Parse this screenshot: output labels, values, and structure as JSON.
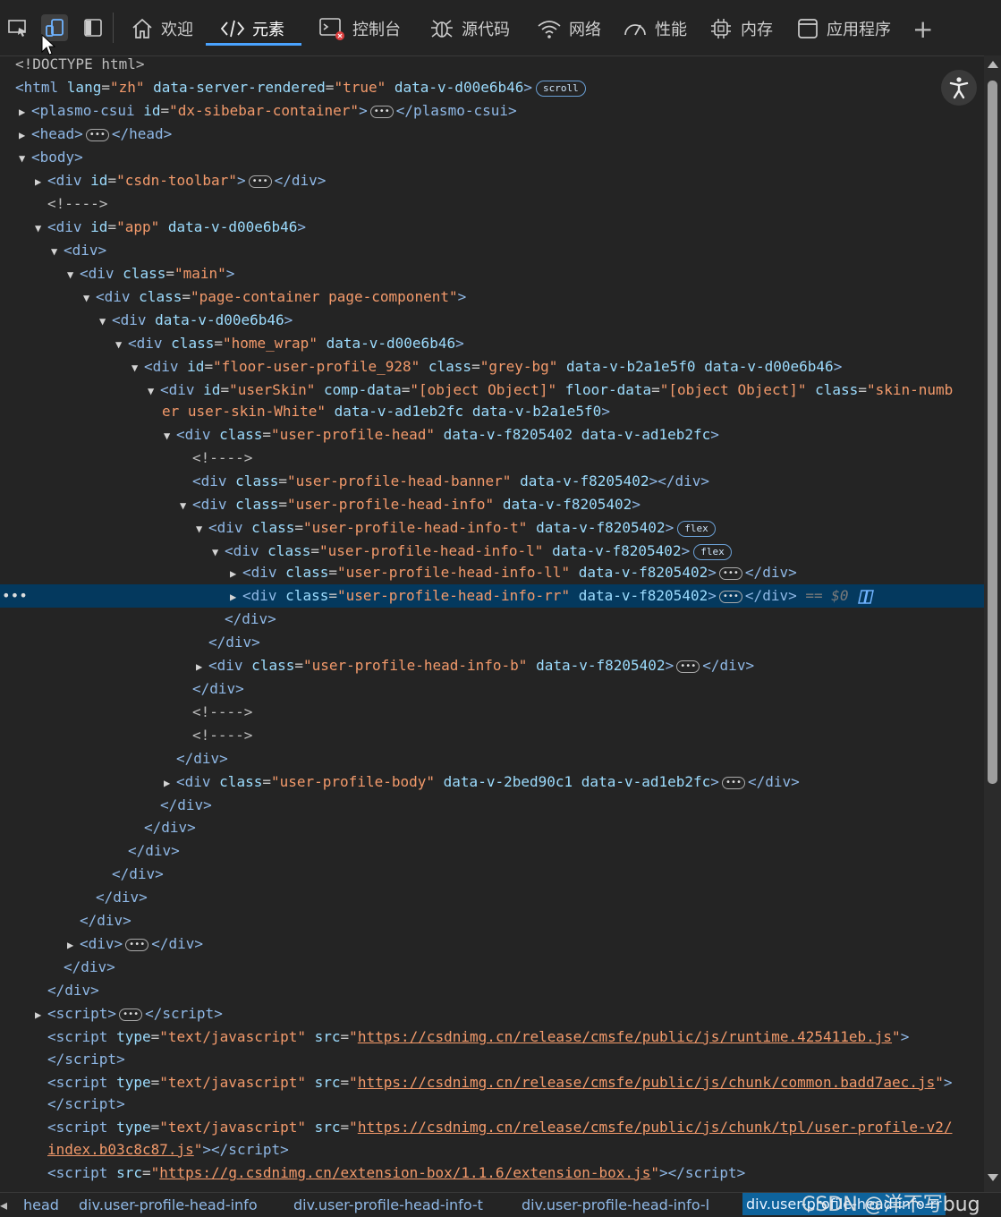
{
  "toolbar": {
    "tabs": [
      {
        "label": "欢迎",
        "icon": "home-icon"
      },
      {
        "label": "元素",
        "icon": "code-icon",
        "active": true
      },
      {
        "label": "控制台",
        "icon": "console-icon",
        "error": true
      },
      {
        "label": "源代码",
        "icon": "bug-icon"
      },
      {
        "label": "网络",
        "icon": "wifi-icon"
      },
      {
        "label": "性能",
        "icon": "gauge-icon"
      },
      {
        "label": "内存",
        "icon": "cpu-icon"
      },
      {
        "label": "应用程序",
        "icon": "window-icon"
      }
    ],
    "add_tab_label": "+"
  },
  "tree": {
    "doctype": "<!DOCTYPE html>",
    "html_lang": "\"zh\"",
    "server_rendered": "\"true\"",
    "data_v_root": "data-v-d00e6b46",
    "badge_scroll": "scroll",
    "badge_flex": "flex",
    "plasmo_id": "\"dx-sibebar-container\"",
    "comment": "<!---->",
    "toolbar_id": "\"csdn-toolbar\"",
    "app_id": "\"app\"",
    "class_main": "\"main\"",
    "class_page": "\"page-container page-component\"",
    "class_home": "\"home_wrap\"",
    "floor_id": "\"floor-user-profile_928\"",
    "class_grey": "\"grey-bg\"",
    "data_v_b2": "data-v-b2a1e5f0",
    "skin_id": "\"userSkin\"",
    "object_val": "\"[object Object]\"",
    "skin_class_1": "\"skin-numb",
    "skin_class_2": "er user-skin-White\"",
    "data_v_ad": "data-v-ad1eb2fc",
    "data_v_f8": "data-v-f8205402",
    "data_v_2b": "data-v-2bed90c1",
    "class_head": "\"user-profile-head\"",
    "class_banner": "\"user-profile-head-banner\"",
    "class_info": "\"user-profile-head-info\"",
    "class_info_t": "\"user-profile-head-info-t\"",
    "class_info_l": "\"user-profile-head-info-l\"",
    "class_info_ll": "\"user-profile-head-info-ll\"",
    "class_info_rr": "\"user-profile-head-info-rr\"",
    "class_info_b": "\"user-profile-head-info-b\"",
    "class_body": "\"user-profile-body\"",
    "selected_marker": "== $0",
    "script_type": "\"text/javascript\"",
    "url_runtime": "https://csdnimg.cn/release/cmsfe/public/js/runtime.425411eb.js",
    "url_common": "https://csdnimg.cn/release/cmsfe/public/js/chunk/common.badd7aec.js",
    "url_tpl_1": "https://csdnimg.cn/release/cmsfe/public/js/chunk/tpl/user-profile-v2/",
    "url_tpl_2": "index.b03c8c87.js",
    "url_ext": "https://g.csdnimg.cn/extension-box/1.1.6/extension-box.js"
  },
  "breadcrumb": [
    "head",
    "div.user-profile-head-info",
    "div.user-profile-head-info-t",
    "div.user-profile-head-info-l",
    "div.user-profile-head-info-rr"
  ],
  "watermark": "CSDN @洋不写bug"
}
